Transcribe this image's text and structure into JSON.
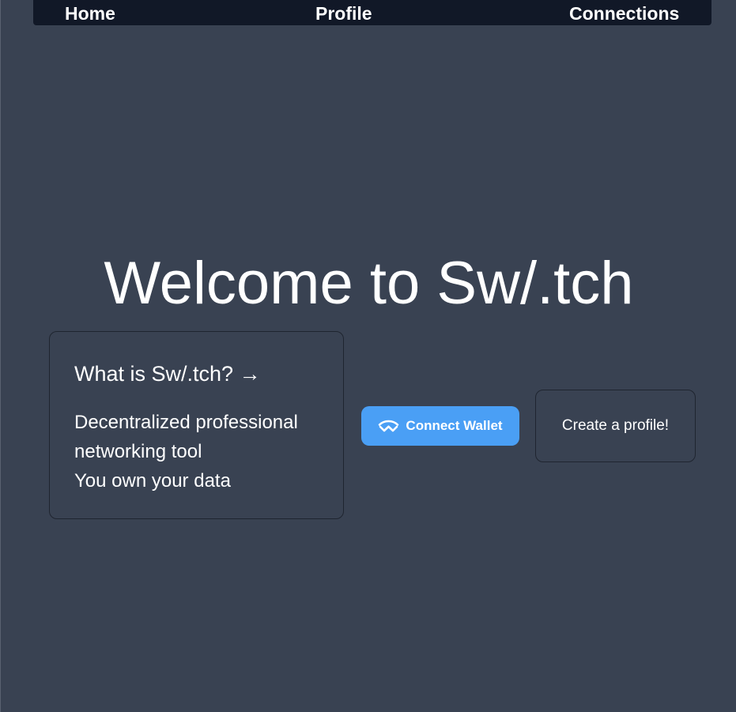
{
  "nav": {
    "home": "Home",
    "profile": "Profile",
    "connections": "Connections"
  },
  "hero": {
    "title": "Welcome to Sw/.tch"
  },
  "info_card": {
    "title": "What is Sw/.tch? →",
    "lines": [
      "Decentralized professional",
      "networking tool",
      "You own your data"
    ]
  },
  "connect_button": {
    "label": "Connect Wallet",
    "icon": "walletconnect-icon"
  },
  "create_card": {
    "label": "Create a profile!"
  },
  "colors": {
    "background": "#394252",
    "navbar": "#111827",
    "accent": "#4a9ff5"
  }
}
